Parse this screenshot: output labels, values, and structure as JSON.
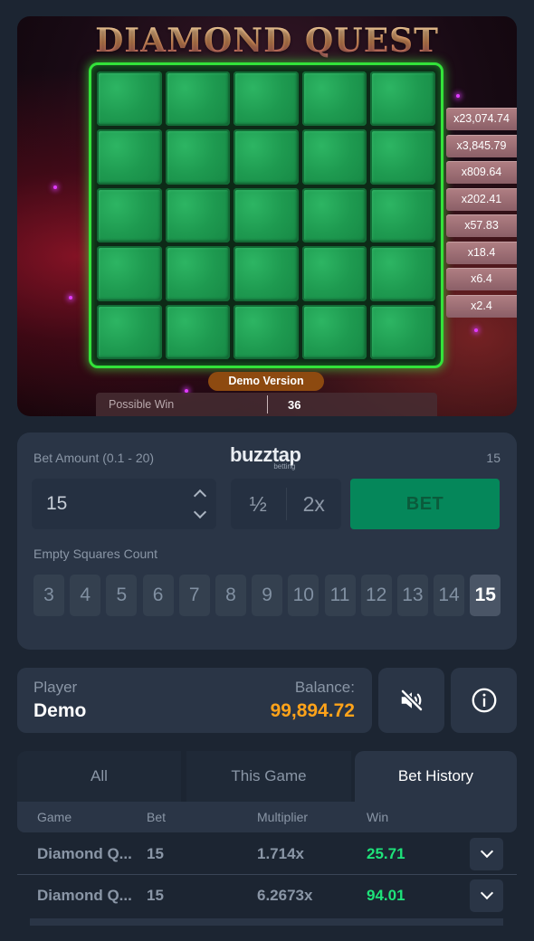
{
  "game": {
    "title": "DIAMOND QUEST",
    "multipliers": [
      "x23,074.74",
      "x3,845.79",
      "x809.64",
      "x202.41",
      "x57.83",
      "x18.4",
      "x6.4",
      "x2.4"
    ],
    "demo_badge": "Demo Version",
    "possible_win_label": "Possible Win",
    "possible_win_value": "36"
  },
  "bet": {
    "label": "Bet Amount (0.1 - 20)",
    "brand_main": "buzztap",
    "brand_sub": "betting",
    "max_display": "15",
    "amount": "15",
    "half_label": "½",
    "double_label": "2x",
    "bet_button": "BET",
    "squares_label": "Empty Squares Count",
    "squares": [
      "3",
      "4",
      "5",
      "6",
      "7",
      "8",
      "9",
      "10",
      "11",
      "12",
      "13",
      "14",
      "15"
    ],
    "selected_square": "15"
  },
  "player": {
    "player_label": "Player",
    "player_name": "Demo",
    "balance_label": "Balance:",
    "balance_value": "99,894.72"
  },
  "history": {
    "tabs": [
      "All",
      "This Game",
      "Bet History"
    ],
    "active_tab": "Bet History",
    "columns": [
      "Game",
      "Bet",
      "Multiplier",
      "Win"
    ],
    "rows": [
      {
        "game": "Diamond Q...",
        "bet": "15",
        "multiplier": "1.714x",
        "win": "25.71"
      },
      {
        "game": "Diamond Q...",
        "bet": "15",
        "multiplier": "6.2673x",
        "win": "94.01"
      }
    ]
  },
  "icons": {
    "mute": "speaker-muted-icon",
    "info": "info-icon",
    "expand": "chevron-down-icon"
  },
  "colors": {
    "background": "#1c2532",
    "panel": "#2a3546",
    "bet_button": "#05875a",
    "balance": "#ffa31a",
    "win": "#1ee37a",
    "board_border": "#33e33a"
  }
}
